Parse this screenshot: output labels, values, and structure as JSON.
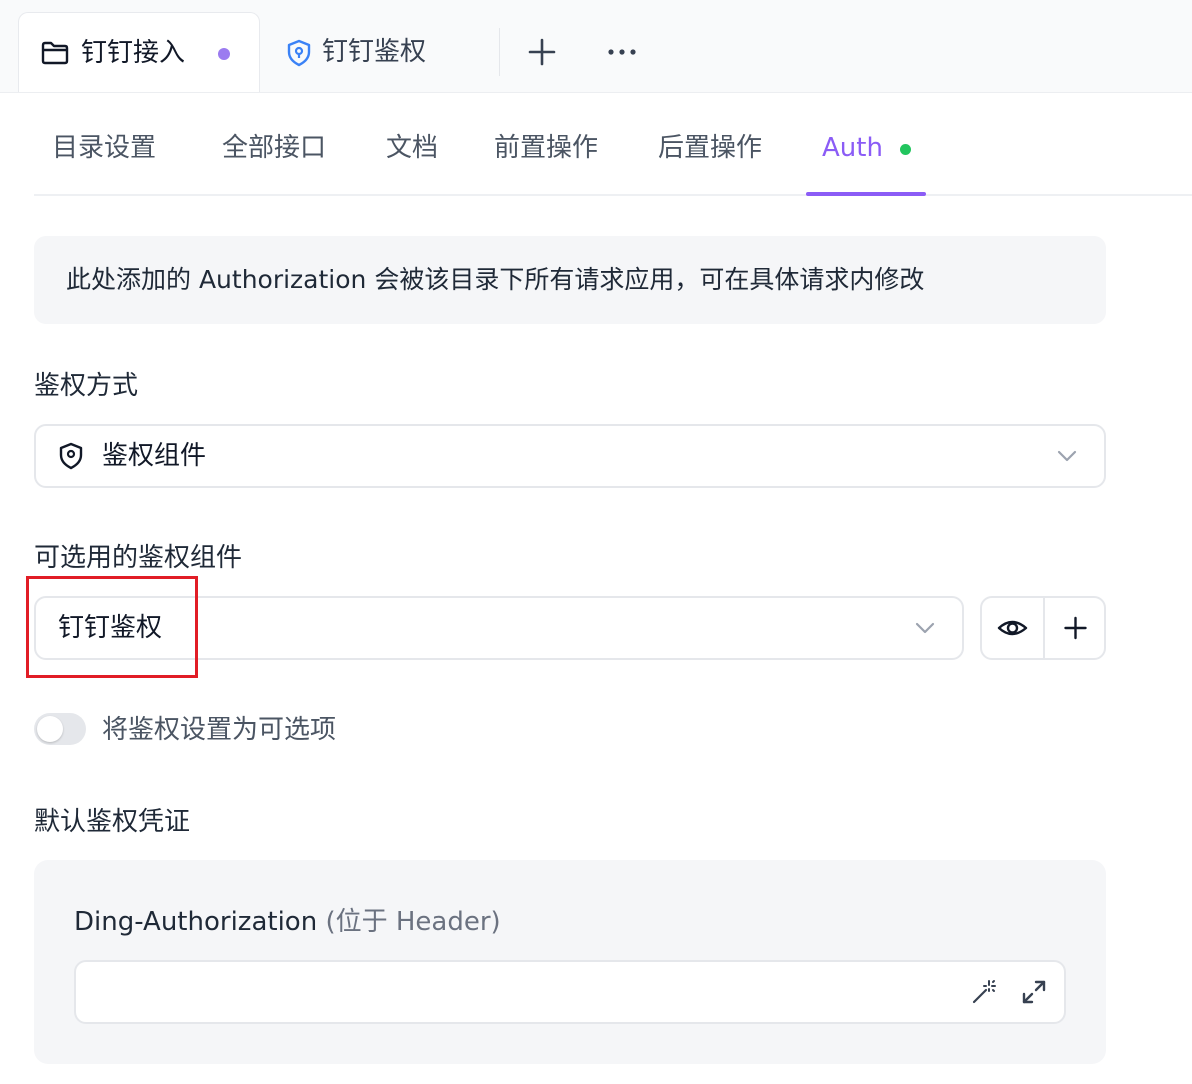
{
  "tabs": [
    {
      "label": "钉钉接入",
      "icon": "folder-icon",
      "active": true,
      "modified_dot_color": "#9b7bf0"
    },
    {
      "label": "钉钉鉴权",
      "icon": "shield-icon",
      "active": false
    }
  ],
  "subnav": {
    "items": [
      "目录设置",
      "全部接口",
      "文档",
      "前置操作",
      "后置操作",
      "Auth"
    ],
    "active": "Auth",
    "active_color": "#8b5cf6",
    "status_dot_color": "#22c55e"
  },
  "info": {
    "text": "此处添加的 Authorization 会被该目录下所有请求应用，可在具体请求内修改"
  },
  "auth_method": {
    "label": "鉴权方式",
    "value": "鉴权组件",
    "icon": "shield-icon"
  },
  "auth_component": {
    "label": "可选用的鉴权组件",
    "value": "钉钉鉴权",
    "preview_icon": "eye-icon",
    "add_icon": "plus-icon",
    "highlight_color": "#e11d26"
  },
  "optional_toggle": {
    "label": "将鉴权设置为可选项",
    "checked": false
  },
  "default_credential": {
    "label": "默认鉴权凭证",
    "field_name": "Ding-Authorization",
    "field_location": "(位于 Header)",
    "value": "",
    "magic_icon": "magic-wand-icon",
    "expand_icon": "expand-icon"
  }
}
